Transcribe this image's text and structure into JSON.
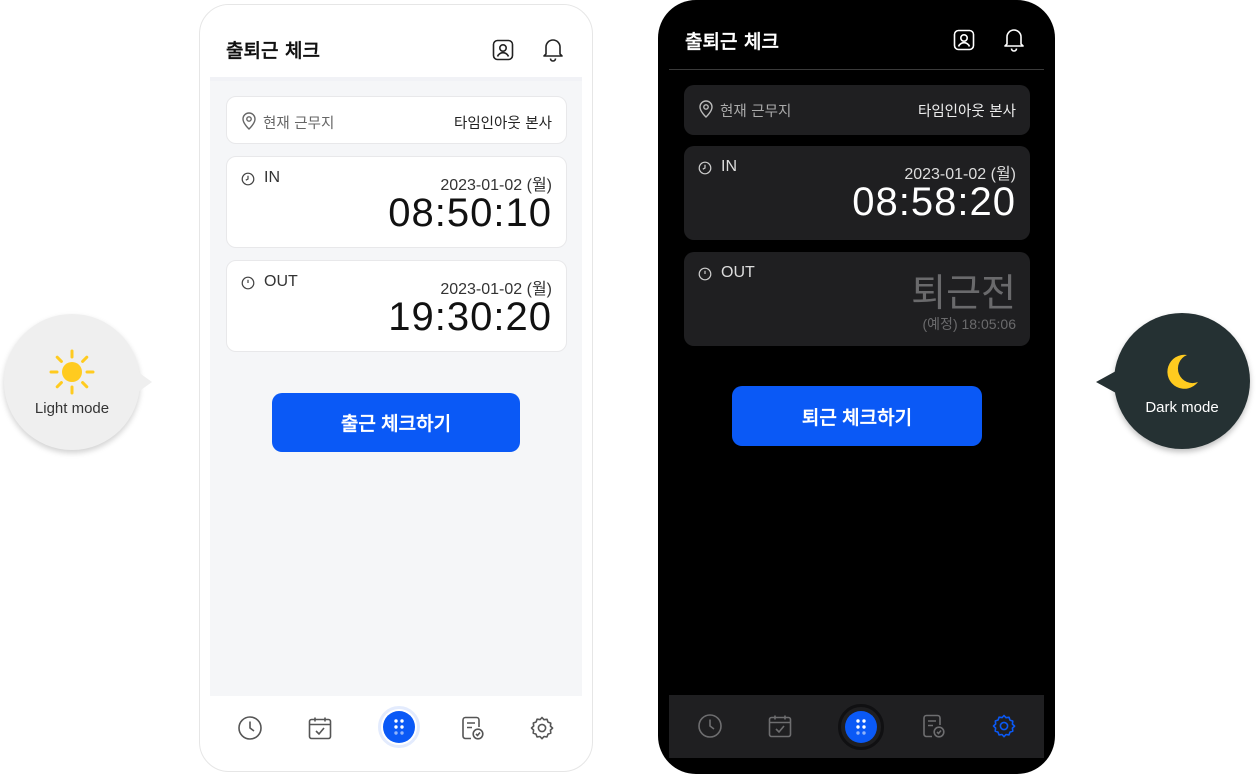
{
  "colors": {
    "accent": "#0a59f6",
    "light_bg": "#f5f6f8",
    "dark_bg": "#000000",
    "dark_card": "#1f1f21",
    "sun": "#ffcb1f",
    "moon": "#ffcb1f",
    "dark_bubble": "#253133"
  },
  "bubbles": {
    "light": {
      "label": "Light mode",
      "icon": "sun-icon"
    },
    "dark": {
      "label": "Dark mode",
      "icon": "moon-icon"
    }
  },
  "light_screen": {
    "header": {
      "title": "출퇴근 체크",
      "icons": [
        "profile-icon",
        "bell-icon"
      ]
    },
    "location": {
      "label": "현재 근무지",
      "value": "타임인아웃 본사"
    },
    "check_in": {
      "label": "IN",
      "date": "2023-01-02 (월)",
      "time": "08:50:10"
    },
    "check_out": {
      "label": "OUT",
      "date": "2023-01-02 (월)",
      "time": "19:30:20"
    },
    "cta_label": "출근 체크하기",
    "tabs": [
      "clock-icon",
      "calendar-check-icon",
      "dots-grid-icon",
      "document-check-icon",
      "gear-icon"
    ],
    "active_tab": "dots-grid-icon"
  },
  "dark_screen": {
    "header": {
      "title": "출퇴근 체크",
      "icons": [
        "profile-icon",
        "bell-icon"
      ]
    },
    "location": {
      "label": "현재 근무지",
      "value": "타임인아웃 본사"
    },
    "check_in": {
      "label": "IN",
      "date": "2023-01-02 (월)",
      "time": "08:58:20"
    },
    "check_out": {
      "label": "OUT",
      "status": "퇴근전",
      "planned": "(예정) 18:05:06"
    },
    "cta_label": "퇴근 체크하기",
    "tabs": [
      "clock-icon",
      "calendar-check-icon",
      "dots-grid-icon",
      "document-check-icon",
      "gear-icon"
    ],
    "active_tab": "gear-icon"
  }
}
